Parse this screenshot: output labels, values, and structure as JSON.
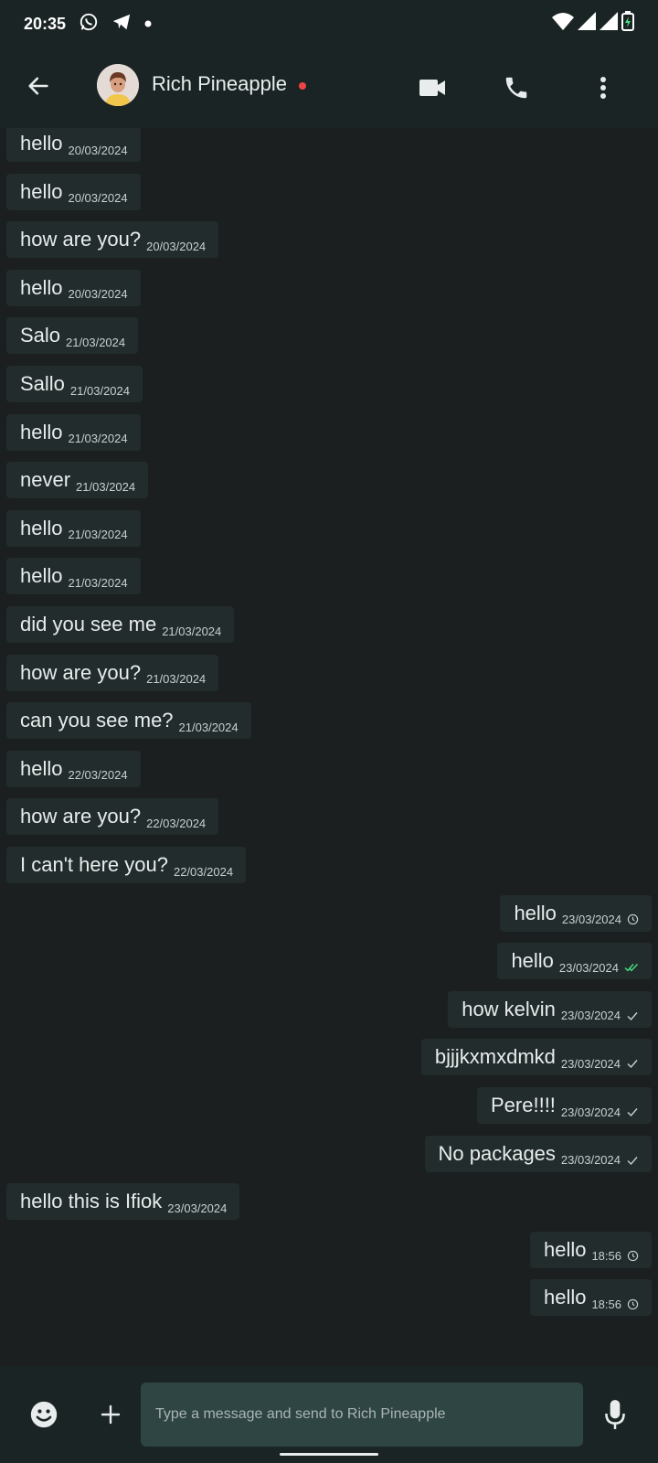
{
  "status_bar": {
    "time": "20:35",
    "left_icons": [
      "whatsapp-icon",
      "telegram-icon",
      "notification-dot-icon"
    ],
    "right_icons": [
      "wifi-icon",
      "signal-icon",
      "signal-icon",
      "battery-charging-icon"
    ]
  },
  "header": {
    "contact_name": "Rich Pineapple",
    "online_indicator_color": "#ef4444",
    "actions": [
      "video-call-icon",
      "phone-call-icon",
      "more-options-icon"
    ]
  },
  "messages": [
    {
      "dir": "in",
      "text": "hello",
      "time": "20/03/2024"
    },
    {
      "dir": "in",
      "text": "hello",
      "time": "20/03/2024"
    },
    {
      "dir": "in",
      "text": "how are you?",
      "time": "20/03/2024"
    },
    {
      "dir": "in",
      "text": "hello",
      "time": "20/03/2024"
    },
    {
      "dir": "in",
      "text": "Salo",
      "time": "21/03/2024"
    },
    {
      "dir": "in",
      "text": "Sallo",
      "time": "21/03/2024"
    },
    {
      "dir": "in",
      "text": "hello",
      "time": "21/03/2024"
    },
    {
      "dir": "in",
      "text": "never",
      "time": "21/03/2024"
    },
    {
      "dir": "in",
      "text": "hello",
      "time": "21/03/2024"
    },
    {
      "dir": "in",
      "text": "hello",
      "time": "21/03/2024"
    },
    {
      "dir": "in",
      "text": "did you see me",
      "time": "21/03/2024"
    },
    {
      "dir": "in",
      "text": "how are you?",
      "time": "21/03/2024"
    },
    {
      "dir": "in",
      "text": "can you see me?",
      "time": "21/03/2024"
    },
    {
      "dir": "in",
      "text": "hello",
      "time": "22/03/2024"
    },
    {
      "dir": "in",
      "text": "how are you?",
      "time": "22/03/2024"
    },
    {
      "dir": "in",
      "text": "I can't here you?",
      "time": "22/03/2024"
    },
    {
      "dir": "out",
      "text": "hello",
      "time": "23/03/2024",
      "status": "pending"
    },
    {
      "dir": "out",
      "text": "hello",
      "time": "23/03/2024",
      "status": "read"
    },
    {
      "dir": "out",
      "text": "how kelvin",
      "time": "23/03/2024",
      "status": "sent"
    },
    {
      "dir": "out",
      "text": "bjjjkxmxdmkd",
      "time": "23/03/2024",
      "status": "sent"
    },
    {
      "dir": "out",
      "text": "Pere!!!!",
      "time": "23/03/2024",
      "status": "sent"
    },
    {
      "dir": "out",
      "text": "No packages",
      "time": "23/03/2024",
      "status": "sent"
    },
    {
      "dir": "in",
      "text": "hello this is Ifiok",
      "time": "23/03/2024"
    },
    {
      "dir": "out",
      "text": "hello",
      "time": "18:56",
      "status": "pending"
    },
    {
      "dir": "out",
      "text": "hello",
      "time": "18:56",
      "status": "pending"
    }
  ],
  "composer": {
    "placeholder": "Type a message and send to Rich Pineapple",
    "left_icons": [
      "emoji-icon",
      "plus-icon"
    ],
    "right_icon": "mic-icon"
  },
  "colors": {
    "background": "#1b1f1f",
    "bar": "#1b2424",
    "bubble": "#222c2c",
    "input": "#2f4544",
    "read_tick": "#4ade80"
  }
}
